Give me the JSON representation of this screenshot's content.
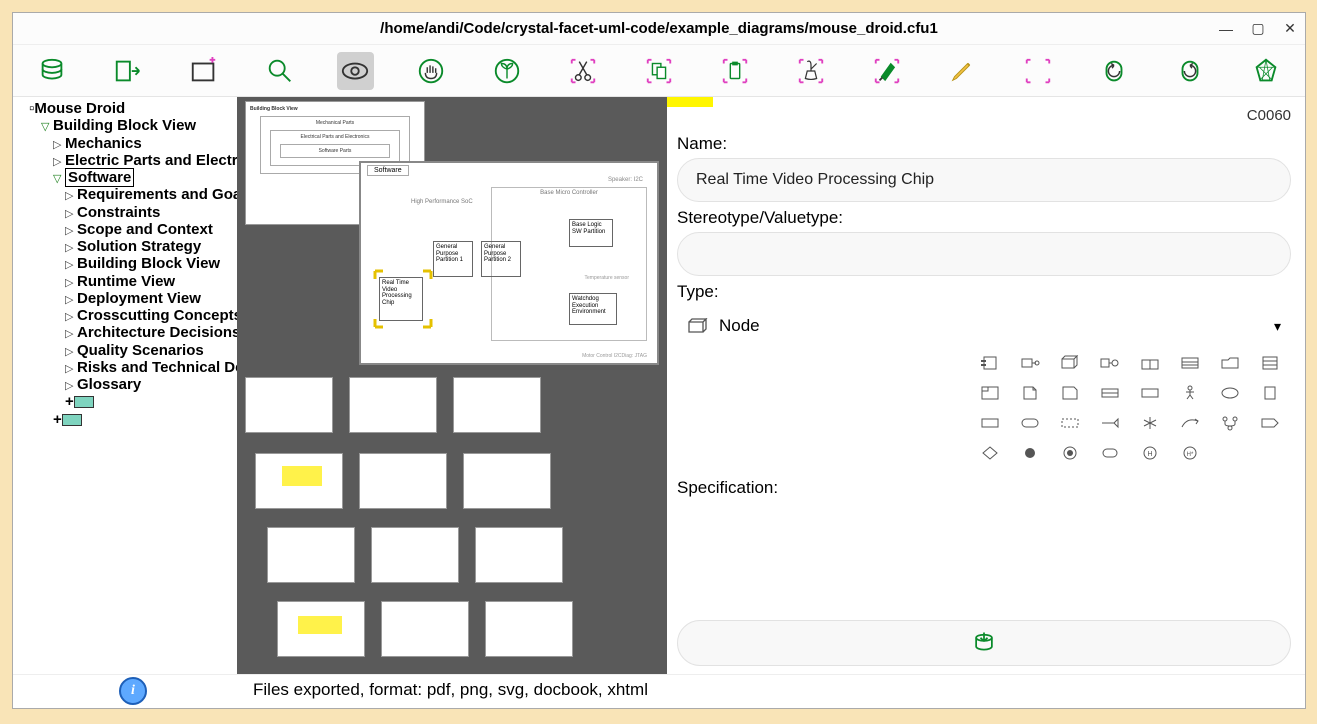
{
  "window": {
    "title": "/home/andi/Code/crystal-facet-uml-code/example_diagrams/mouse_droid.cfu1"
  },
  "tree": {
    "root": "Mouse Droid",
    "l1": "Building Block View",
    "l2": [
      "Mechanics",
      "Electric Parts and Electronics",
      "Software"
    ],
    "l3": [
      "Requirements and Goals",
      "Constraints",
      "Scope and Context",
      "Solution Strategy",
      "Building Block View",
      "Runtime View",
      "Deployment View",
      "Crosscutting Concepts",
      "Architecture Decisions",
      "Quality Scenarios",
      "Risks and Technical Debts",
      "Glossary"
    ]
  },
  "detail": {
    "id": "C0060",
    "name_label": "Name:",
    "name_value": "Real Time Video Processing Chip",
    "stereo_label": "Stereotype/Valuetype:",
    "stereo_value": "",
    "type_label": "Type:",
    "type_value": "Node",
    "spec_label": "Specification:"
  },
  "canvas": {
    "main_diag": {
      "title": "Software",
      "subtitle": "High Performance SoC",
      "blocks": [
        "Real Time Video Processing Chip",
        "General Purpose Partition 1",
        "General Purpose Partition 2",
        "Base Logic SW Partition",
        "Watchdog Execution Environment"
      ],
      "notes": [
        "Speaker: I2C",
        "Base Micro Controller",
        "Temperature sensor",
        "Motor Control I2CDiag: JTAG"
      ]
    },
    "back_diag": {
      "title": "Building Block View",
      "rows": [
        "Mechanical Parts",
        "Electrical Parts and Electronics",
        "Software Parts"
      ]
    }
  },
  "status": {
    "message": "Files exported, format: pdf, png, svg, docbook, xhtml"
  }
}
